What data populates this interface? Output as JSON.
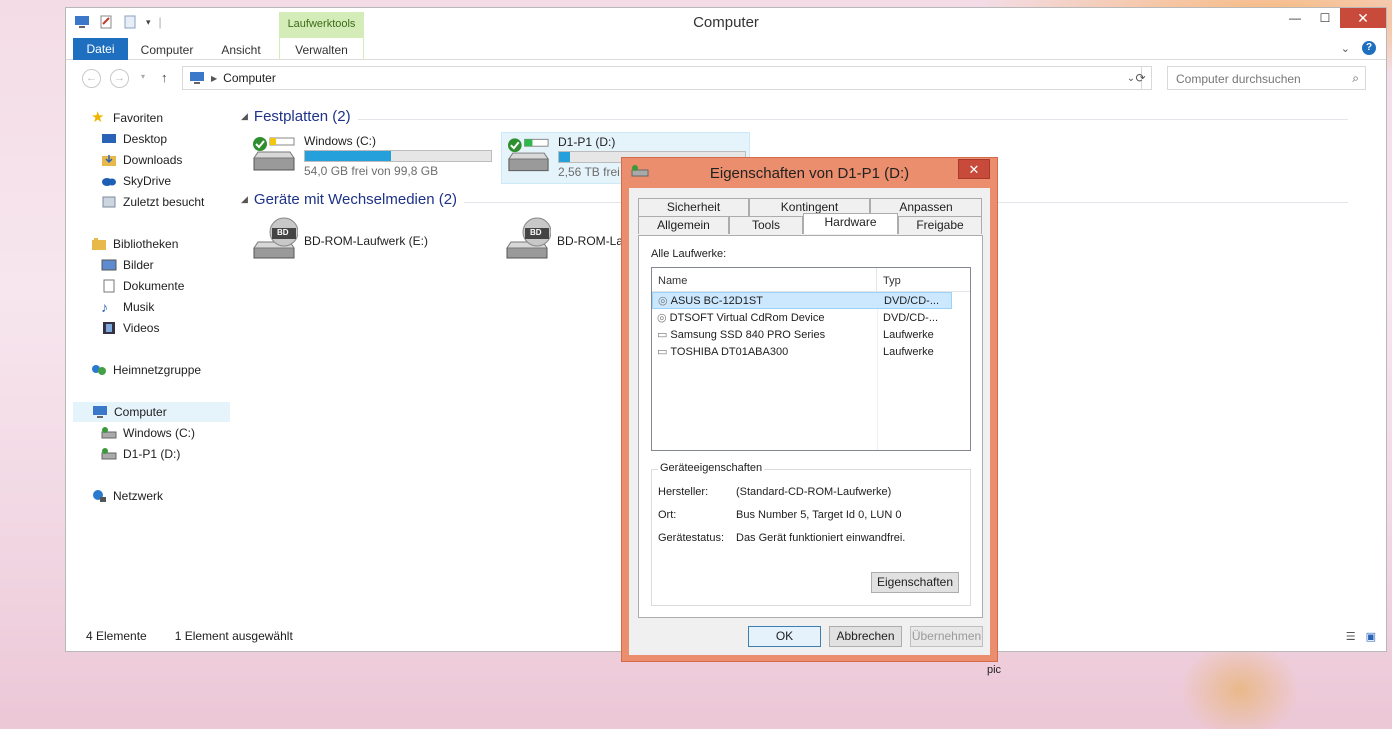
{
  "window": {
    "title": "Computer",
    "context_tab": "Laufwerktools",
    "ribbon_tabs": [
      "Datei",
      "Computer",
      "Ansicht",
      "Verwalten"
    ],
    "controls": {
      "minimize": "—",
      "maximize": "☐",
      "close": "✕"
    }
  },
  "address": {
    "path": "Computer",
    "search_placeholder": "Computer durchsuchen"
  },
  "nav": {
    "favorites": "Favoriten",
    "favorites_items": [
      "Desktop",
      "Downloads",
      "SkyDrive",
      "Zuletzt besucht"
    ],
    "libraries": "Bibliotheken",
    "libraries_items": [
      "Bilder",
      "Dokumente",
      "Musik",
      "Videos"
    ],
    "homegroup": "Heimnetzgruppe",
    "computer": "Computer",
    "computer_items": [
      "Windows (C:)",
      "D1-P1 (D:)"
    ],
    "network": "Netzwerk"
  },
  "content": {
    "group_hdd": "Festplatten (2)",
    "group_removable": "Geräte mit Wechselmedien (2)",
    "drive_c": {
      "name": "Windows (C:)",
      "free": "54,0 GB frei von 99,8 GB",
      "used_fraction": 0.46
    },
    "drive_d": {
      "name": "D1-P1 (D:)",
      "free": "2,56 TB frei v",
      "used_fraction": 0.06
    },
    "drive_e": {
      "name": "BD-ROM-Laufwerk (E:)"
    },
    "drive_f": {
      "name": "BD-ROM-La"
    },
    "bd_badge": "BD"
  },
  "status": {
    "count": "4 Elemente",
    "selected": "1 Element ausgewählt"
  },
  "dialog": {
    "title": "Eigenschaften von D1-P1 (D:)",
    "close": "✕",
    "tabs_back": [
      "Sicherheit",
      "Kontingent",
      "Anpassen"
    ],
    "tabs_front": [
      "Allgemein",
      "Tools",
      "Hardware",
      "Freigabe"
    ],
    "all_drives_label": "Alle Laufwerke:",
    "columns": [
      "Name",
      "Typ"
    ],
    "rows": [
      {
        "name": "ASUS BC-12D1ST",
        "type": "DVD/CD-..."
      },
      {
        "name": "DTSOFT Virtual CdRom Device",
        "type": "DVD/CD-..."
      },
      {
        "name": "Samsung SSD 840 PRO Series",
        "type": "Laufwerke"
      },
      {
        "name": "TOSHIBA DT01ABA300",
        "type": "Laufwerke"
      }
    ],
    "device_props_legend": "Geräteeigenschaften",
    "manufacturer_label": "Hersteller:",
    "manufacturer_value": "(Standard-CD-ROM-Laufwerke)",
    "location_label": "Ort:",
    "location_value": "Bus Number 5, Target Id 0, LUN 0",
    "status_label": "Gerätestatus:",
    "status_value": "Das Gerät funktioniert einwandfrei.",
    "properties_button": "Eigenschaften",
    "ok": "OK",
    "cancel": "Abbrechen",
    "apply": "Übernehmen"
  },
  "cursor_label": "pic",
  "colors": {
    "accent": "#1e6fc0",
    "dialog_frame": "#eb8e6e",
    "close": "#c74a3b",
    "context_tab": "#d4ecb8"
  }
}
